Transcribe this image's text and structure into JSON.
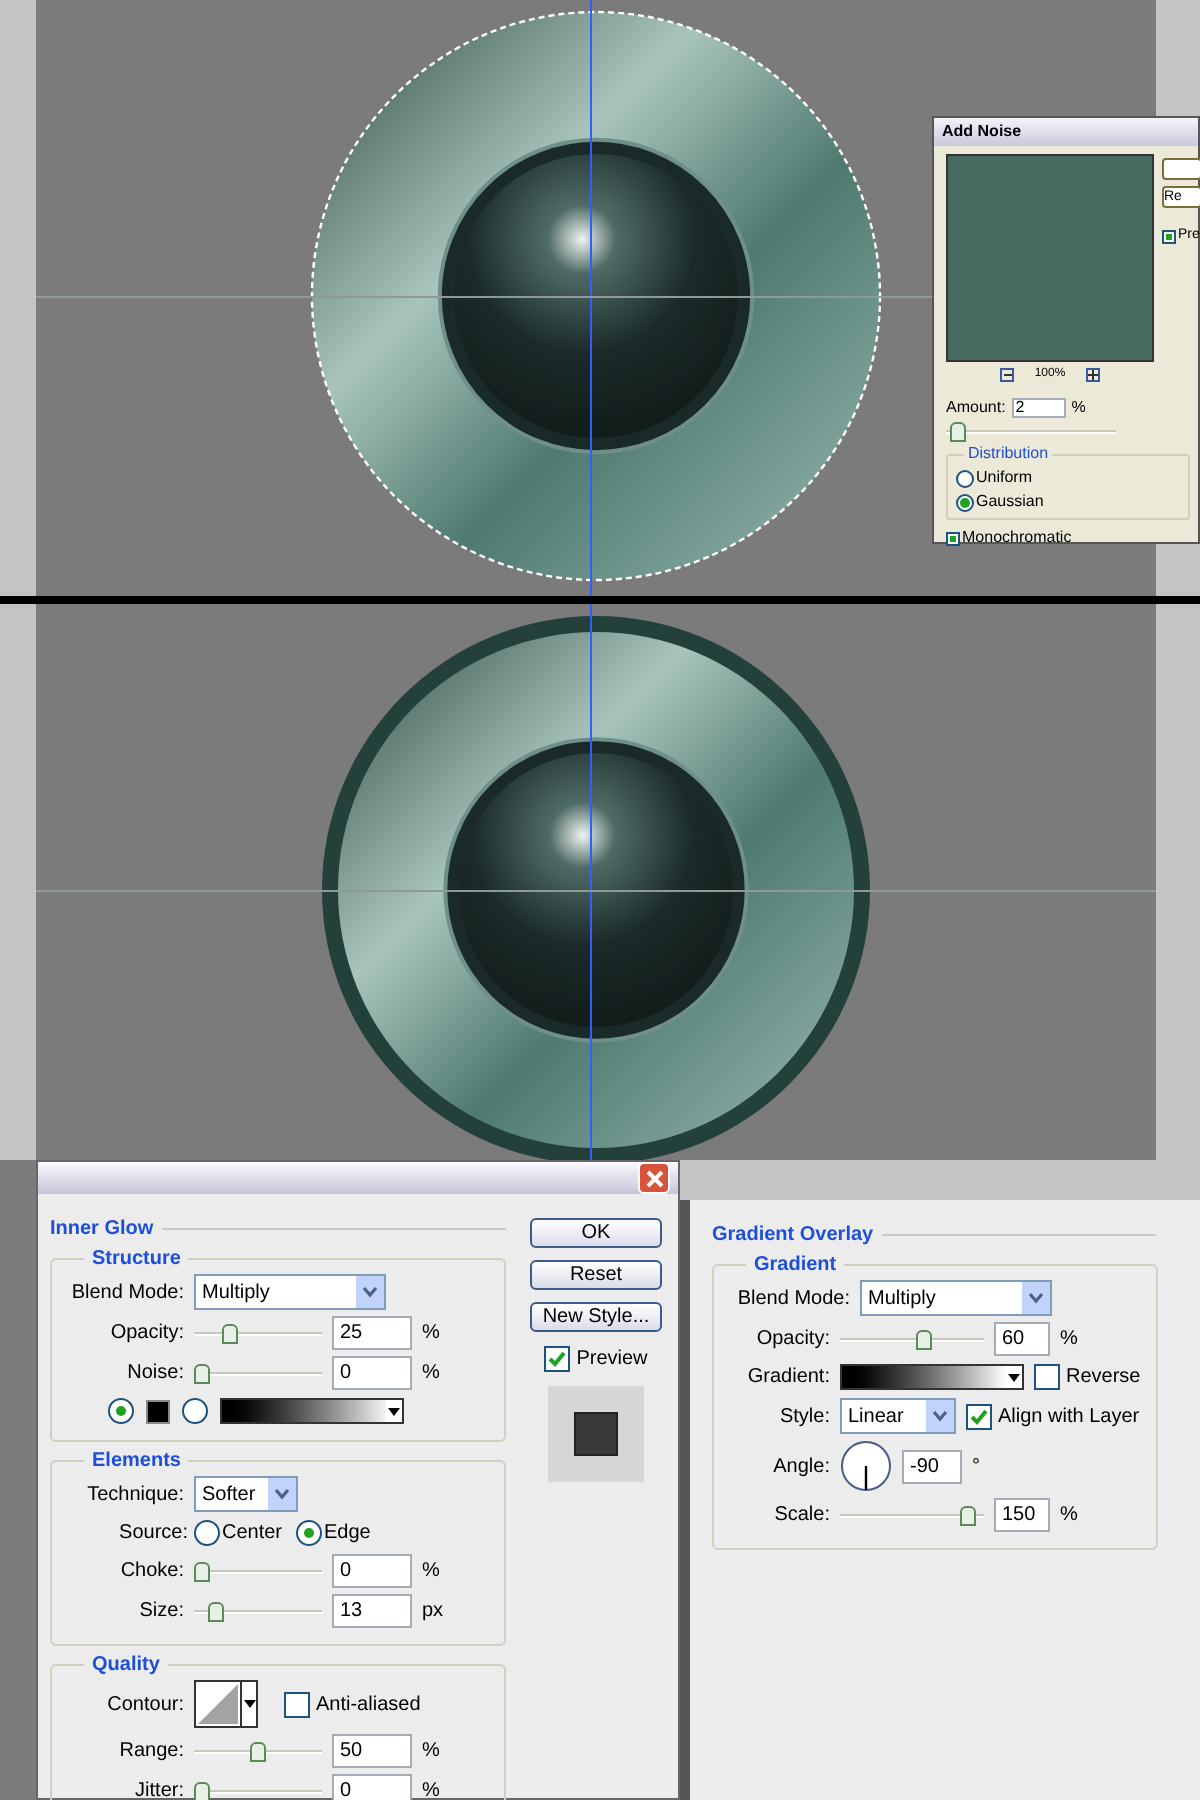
{
  "add_noise": {
    "title": "Add Noise",
    "buttons": [
      {
        "label": "Re"
      }
    ],
    "preview": {
      "label": "Pre",
      "checked": true
    },
    "zoom": "100%",
    "amount": {
      "label": "Amount:",
      "value": "2",
      "unit": "%",
      "level": 0.02
    },
    "distribution": {
      "title": "Distribution",
      "options": [
        {
          "label": "Uniform",
          "selected": false
        },
        {
          "label": "Gaussian",
          "selected": true
        }
      ]
    },
    "monochromatic": {
      "label": "Monochromatic",
      "checked": true
    }
  },
  "inner_glow": {
    "title": "Inner Glow",
    "structure": {
      "title": "Structure",
      "blend_label": "Blend Mode:",
      "blend_mode": "Multiply",
      "sliders": [
        {
          "label": "Opacity:",
          "value": "25",
          "unit": "%",
          "level": 0.25
        },
        {
          "label": "Noise:",
          "value": "0",
          "unit": "%",
          "level": 0
        }
      ],
      "fill": [
        {
          "kind": "color",
          "selected": true
        },
        {
          "kind": "gradient",
          "selected": false
        }
      ]
    },
    "elements": {
      "title": "Elements",
      "technique_label": "Technique:",
      "technique": "Softer",
      "source_label": "Source:",
      "source": [
        {
          "label": "Center",
          "selected": false
        },
        {
          "label": "Edge",
          "selected": true
        }
      ],
      "sliders": [
        {
          "label": "Choke:",
          "value": "0",
          "unit": "%",
          "level": 0
        },
        {
          "label": "Size:",
          "value": "13",
          "unit": "px",
          "level": 0.12
        }
      ]
    },
    "quality": {
      "title": "Quality",
      "contour_label": "Contour:",
      "anti_aliased": {
        "label": "Anti-aliased",
        "checked": false
      },
      "sliders": [
        {
          "label": "Range:",
          "value": "50",
          "unit": "%",
          "level": 0.5
        },
        {
          "label": "Jitter:",
          "value": "0",
          "unit": "%",
          "level": 0
        }
      ]
    }
  },
  "buttons": [
    "OK",
    "Reset",
    "New Style..."
  ],
  "preview": {
    "label": "Preview",
    "checked": true
  },
  "gradient_overlay": {
    "title": "Gradient Overlay",
    "group": "Gradient",
    "blend_label": "Blend Mode:",
    "blend_mode": "Multiply",
    "opacity": {
      "label": "Opacity:",
      "value": "60",
      "unit": "%",
      "level": 0.6
    },
    "gradient_label": "Gradient:",
    "reverse": {
      "label": "Reverse",
      "checked": false
    },
    "style_label": "Style:",
    "style": "Linear",
    "align": {
      "label": "Align with Layer",
      "checked": true
    },
    "angle": {
      "label": "Angle:",
      "value": "-90",
      "unit": "°"
    },
    "scale": {
      "label": "Scale:",
      "value": "150",
      "unit": "%",
      "level": 0.93
    }
  }
}
